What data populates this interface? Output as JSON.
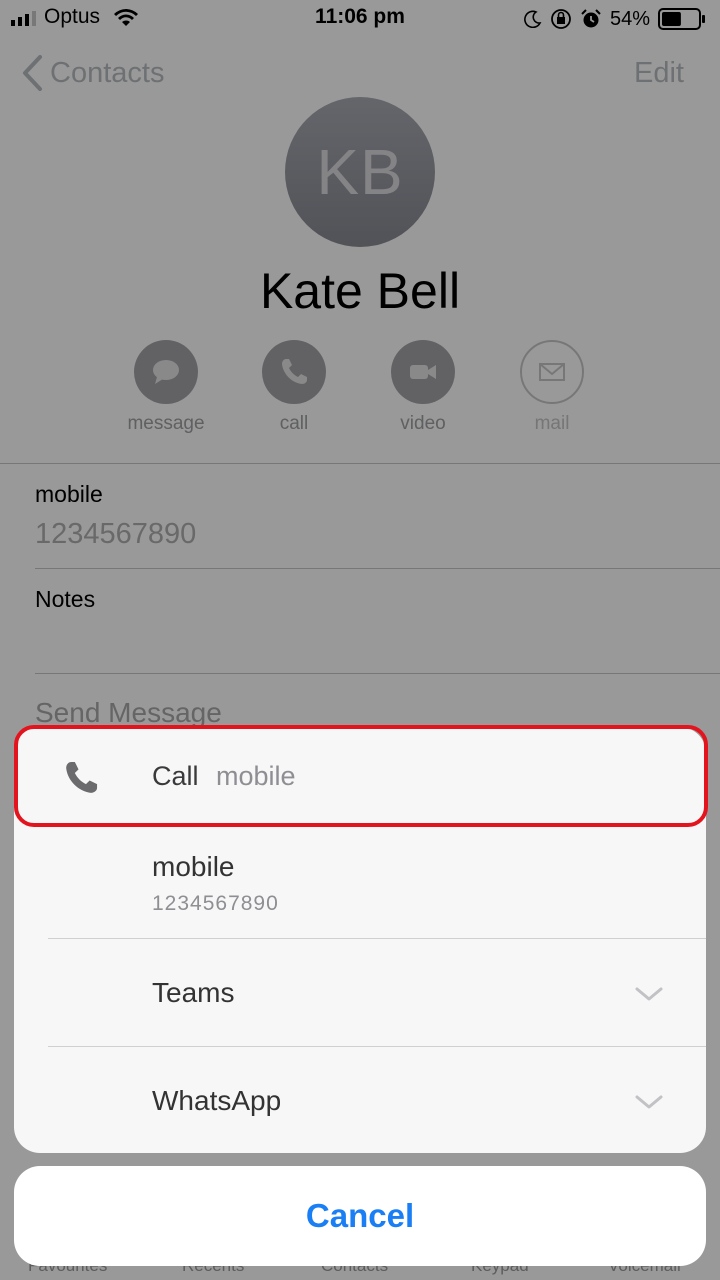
{
  "status_bar": {
    "carrier": "Optus",
    "time": "11:06 pm",
    "battery": "54%",
    "battery_level": 0.54
  },
  "nav": {
    "back_label": "Contacts",
    "edit_label": "Edit"
  },
  "contact": {
    "initials": "KB",
    "name": "Kate Bell"
  },
  "actions": [
    {
      "label": "message",
      "icon": "message-bubble-icon",
      "enabled": true
    },
    {
      "label": "call",
      "icon": "phone-icon",
      "enabled": true
    },
    {
      "label": "video",
      "icon": "video-camera-icon",
      "enabled": true
    },
    {
      "label": "mail",
      "icon": "envelope-icon",
      "enabled": false
    }
  ],
  "details": {
    "phone_label": "mobile",
    "phone_number": "1234567890",
    "notes_label": "Notes",
    "send_message": "Send Message"
  },
  "tabbar": [
    "Favourites",
    "Recents",
    "Contacts",
    "Keypad",
    "Voicemail"
  ],
  "sheet": {
    "title": "Call",
    "subtitle": "mobile",
    "number_label": "mobile",
    "number": "1234567890",
    "options": [
      "Teams",
      "WhatsApp"
    ],
    "cancel": "Cancel"
  },
  "colors": {
    "accent": "#1a7ff5",
    "highlight": "#e3141e"
  }
}
